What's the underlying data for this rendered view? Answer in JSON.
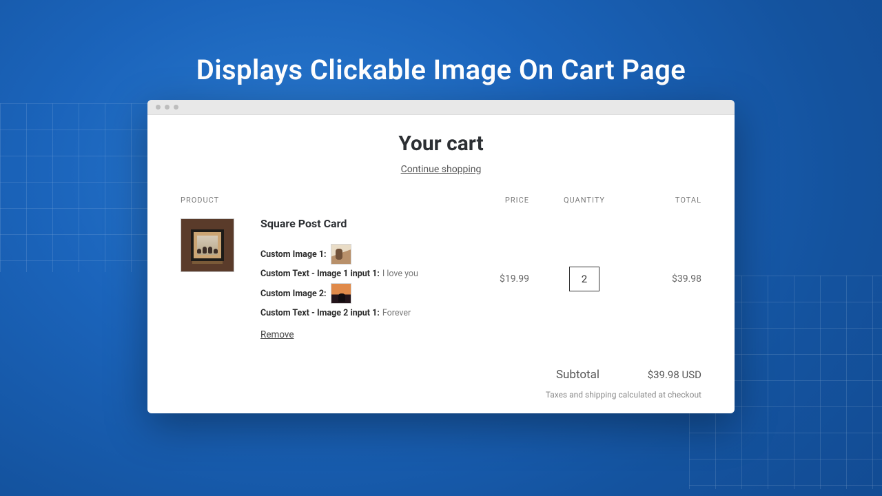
{
  "headline": "Displays Clickable Image On Cart Page",
  "cart": {
    "title": "Your cart",
    "continue": "Continue shopping",
    "columns": {
      "product": "PRODUCT",
      "price": "PRICE",
      "quantity": "QUANTITY",
      "total": "TOTAL"
    },
    "item": {
      "title": "Square Post Card",
      "custom_image_1_label": "Custom Image 1:",
      "custom_text_1_label": "Custom Text - Image 1 input 1:",
      "custom_text_1_value": "I love you",
      "custom_image_2_label": "Custom Image 2:",
      "custom_text_2_label": "Custom Text - Image 2 input 1:",
      "custom_text_2_value": "Forever",
      "remove": "Remove",
      "price": "$19.99",
      "quantity": "2",
      "total": "$39.98"
    },
    "subtotal_label": "Subtotal",
    "subtotal_value": "$39.98 USD",
    "tax_note": "Taxes and shipping calculated at checkout"
  }
}
